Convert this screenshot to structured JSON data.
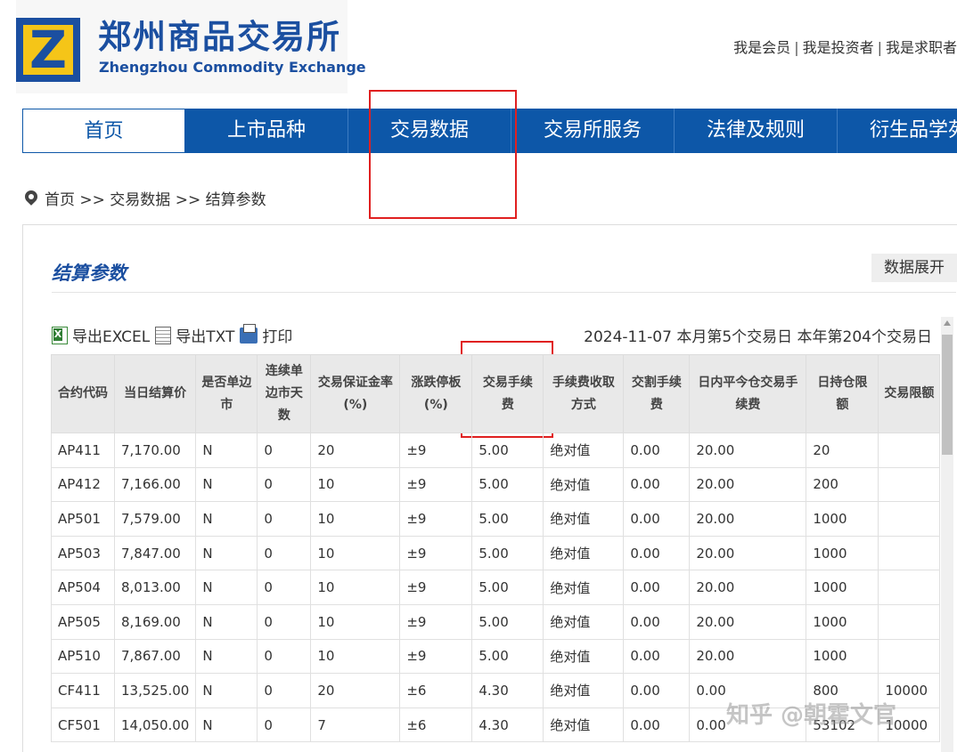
{
  "header": {
    "logo_cn": "郑州商品交易所",
    "logo_en": "Zhengzhou Commodity Exchange",
    "links": [
      "我是会员",
      "我是投资者",
      "我是求职者"
    ]
  },
  "nav": [
    "首页",
    "上市品种",
    "交易数据",
    "交易所服务",
    "法律及规则",
    "衍生品学苑"
  ],
  "breadcrumb": "首页 >> 交易数据 >> 结算参数",
  "panel": {
    "title": "结算参数",
    "expand": "数据展开",
    "export_excel": "导出EXCEL",
    "export_txt": "导出TXT",
    "print": "打印",
    "date_info": "2024-11-07  本月第5个交易日  本年第204个交易日"
  },
  "table": {
    "headers": [
      "合约代码",
      "当日结算价",
      "是否单边市",
      "连续单边市天数",
      "交易保证金率(%)",
      "涨跌停板(%)",
      "交易手续费",
      "手续费收取方式",
      "交割手续费",
      "日内平今仓交易手续费",
      "日持仓限额",
      "交易限额"
    ],
    "rows": [
      [
        "AP411",
        "7,170.00",
        "N",
        "0",
        "20",
        "±9",
        "5.00",
        "绝对值",
        "0.00",
        "20.00",
        "20",
        ""
      ],
      [
        "AP412",
        "7,166.00",
        "N",
        "0",
        "10",
        "±9",
        "5.00",
        "绝对值",
        "0.00",
        "20.00",
        "200",
        ""
      ],
      [
        "AP501",
        "7,579.00",
        "N",
        "0",
        "10",
        "±9",
        "5.00",
        "绝对值",
        "0.00",
        "20.00",
        "1000",
        ""
      ],
      [
        "AP503",
        "7,847.00",
        "N",
        "0",
        "10",
        "±9",
        "5.00",
        "绝对值",
        "0.00",
        "20.00",
        "1000",
        ""
      ],
      [
        "AP504",
        "8,013.00",
        "N",
        "0",
        "10",
        "±9",
        "5.00",
        "绝对值",
        "0.00",
        "20.00",
        "1000",
        ""
      ],
      [
        "AP505",
        "8,169.00",
        "N",
        "0",
        "10",
        "±9",
        "5.00",
        "绝对值",
        "0.00",
        "20.00",
        "1000",
        ""
      ],
      [
        "AP510",
        "7,867.00",
        "N",
        "0",
        "10",
        "±9",
        "5.00",
        "绝对值",
        "0.00",
        "20.00",
        "1000",
        ""
      ],
      [
        "CF411",
        "13,525.00",
        "N",
        "0",
        "20",
        "±6",
        "4.30",
        "绝对值",
        "0.00",
        "0.00",
        "800",
        "10000"
      ],
      [
        "CF501",
        "14,050.00",
        "N",
        "0",
        "7",
        "±6",
        "4.30",
        "绝对值",
        "0.00",
        "0.00",
        "53102",
        "10000"
      ]
    ]
  },
  "watermark": "知乎 @朝霍文官",
  "colors": {
    "brand_blue": "#0d57a8",
    "highlight_red": "#e02020",
    "logo_yellow": "#f5c518"
  }
}
